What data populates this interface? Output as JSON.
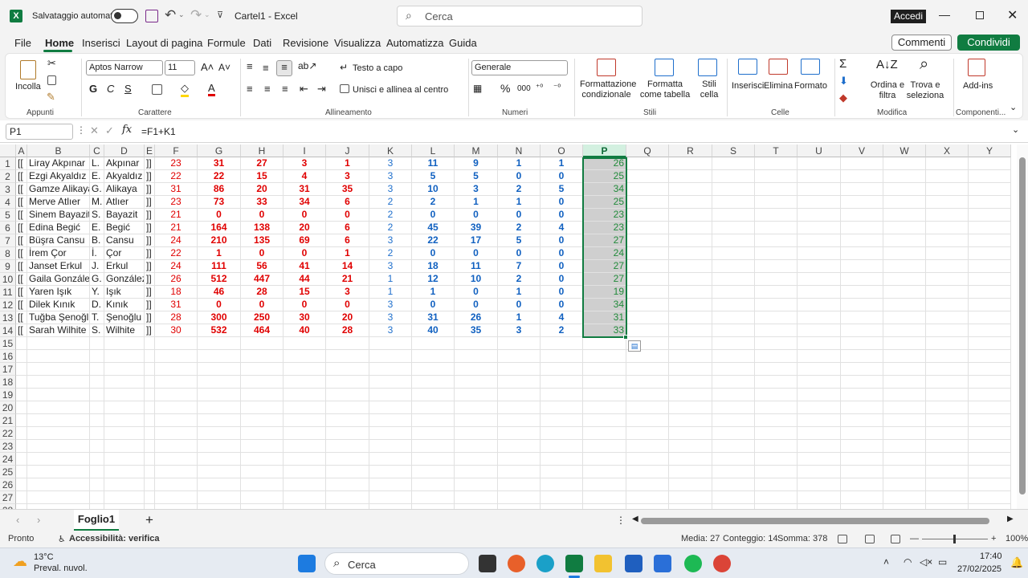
{
  "titlebar": {
    "autosave_label": "Salvataggio automatico",
    "doc_title": "Cartel1 - Excel",
    "search_placeholder": "Cerca",
    "signin_label": "Accedi",
    "app_icon_letter": "X"
  },
  "menu": {
    "items": [
      "File",
      "Home",
      "Inserisci",
      "Layout di pagina",
      "Formule",
      "Dati",
      "Revisione",
      "Visualizza",
      "Automatizza",
      "Guida"
    ],
    "comments_label": "Commenti",
    "share_label": "Condividi"
  },
  "ribbon": {
    "appunti": {
      "label": "Appunti",
      "paste": "Incolla"
    },
    "carattere": {
      "label": "Carattere",
      "font": "Aptos Narrow",
      "size": "11",
      "bold": "G",
      "italic": "C",
      "underline": "S"
    },
    "allineamento": {
      "label": "Allineamento",
      "wrap": "Testo a capo",
      "merge": "Unisci e allinea al centro"
    },
    "numeri": {
      "label": "Numeri",
      "format": "Generale"
    },
    "stili": {
      "label": "Stili",
      "cond": "Formattazione condizionale",
      "table": "Formatta come tabella",
      "cell": "Stili cella"
    },
    "celle": {
      "label": "Celle",
      "insert": "Inserisci",
      "delete": "Elimina",
      "format": "Formato"
    },
    "modifica": {
      "label": "Modifica",
      "sort": "Ordina e filtra",
      "find": "Trova e seleziona"
    },
    "componenti": {
      "label": "Componenti...",
      "addins": "Add-ins"
    }
  },
  "formula": {
    "namebox": "P1",
    "fx": "fx",
    "content": "=F1+K1"
  },
  "columns": [
    "A",
    "B",
    "C",
    "D",
    "E",
    "F",
    "G",
    "H",
    "I",
    "J",
    "K",
    "L",
    "M",
    "N",
    "O",
    "P",
    "Q",
    "R",
    "S",
    "T",
    "U",
    "V",
    "W",
    "X",
    "Y"
  ],
  "selected_column": "P",
  "rows": [
    {
      "n": "1",
      "a": "[[",
      "b": "Liray Akpınar",
      "c": "L.",
      "d": "Akpınar",
      "e": "]]",
      "f": "23",
      "g": "31",
      "h": "27",
      "i": "3",
      "j": "1",
      "k": "3",
      "l": "11",
      "m": "9",
      "nn": "1",
      "o": "1",
      "p": "26"
    },
    {
      "n": "2",
      "a": "[[",
      "b": "Ezgi Akyaldız",
      "c": "E.",
      "d": "Akyaldız",
      "e": "]]",
      "f": "22",
      "g": "22",
      "h": "15",
      "i": "4",
      "j": "3",
      "k": "3",
      "l": "5",
      "m": "5",
      "nn": "0",
      "o": "0",
      "p": "25"
    },
    {
      "n": "3",
      "a": "[[",
      "b": "Gamze Alikaya",
      "c": "G.",
      "d": "Alikaya",
      "e": "]]",
      "f": "31",
      "g": "86",
      "h": "20",
      "i": "31",
      "j": "35",
      "k": "3",
      "l": "10",
      "m": "3",
      "nn": "2",
      "o": "5",
      "p": "34"
    },
    {
      "n": "4",
      "a": "[[",
      "b": "Merve Atlıer",
      "c": "M.",
      "d": "Atlıer",
      "e": "]]",
      "f": "23",
      "g": "73",
      "h": "33",
      "i": "34",
      "j": "6",
      "k": "2",
      "l": "2",
      "m": "1",
      "nn": "1",
      "o": "0",
      "p": "25"
    },
    {
      "n": "5",
      "a": "[[",
      "b": "Sinem Bayazit",
      "c": "S.",
      "d": "Bayazit",
      "e": "]]",
      "f": "21",
      "g": "0",
      "h": "0",
      "i": "0",
      "j": "0",
      "k": "2",
      "l": "0",
      "m": "0",
      "nn": "0",
      "o": "0",
      "p": "23"
    },
    {
      "n": "6",
      "a": "[[",
      "b": "Edina Begić",
      "c": "E.",
      "d": "Begić",
      "e": "]]",
      "f": "21",
      "g": "164",
      "h": "138",
      "i": "20",
      "j": "6",
      "k": "2",
      "l": "45",
      "m": "39",
      "nn": "2",
      "o": "4",
      "p": "23"
    },
    {
      "n": "7",
      "a": "[[",
      "b": "Büşra Cansu",
      "c": "B.",
      "d": "Cansu",
      "e": "]]",
      "f": "24",
      "g": "210",
      "h": "135",
      "i": "69",
      "j": "6",
      "k": "3",
      "l": "22",
      "m": "17",
      "nn": "5",
      "o": "0",
      "p": "27"
    },
    {
      "n": "8",
      "a": "[[",
      "b": "İrem Çor",
      "c": "İ.",
      "d": "Çor",
      "e": "]]",
      "f": "22",
      "g": "1",
      "h": "0",
      "i": "0",
      "j": "1",
      "k": "2",
      "l": "0",
      "m": "0",
      "nn": "0",
      "o": "0",
      "p": "24"
    },
    {
      "n": "9",
      "a": "[[",
      "b": "Janset Erkul",
      "c": "J.",
      "d": "Erkul",
      "e": "]]",
      "f": "24",
      "g": "111",
      "h": "56",
      "i": "41",
      "j": "14",
      "k": "3",
      "l": "18",
      "m": "11",
      "nn": "7",
      "o": "0",
      "p": "27"
    },
    {
      "n": "10",
      "a": "[[",
      "b": "Gaila González",
      "c": "G.",
      "d": "González",
      "e": "]]",
      "f": "26",
      "g": "512",
      "h": "447",
      "i": "44",
      "j": "21",
      "k": "1",
      "l": "12",
      "m": "10",
      "nn": "2",
      "o": "0",
      "p": "27"
    },
    {
      "n": "11",
      "a": "[[",
      "b": "Yaren Işık",
      "c": "Y.",
      "d": "Işık",
      "e": "]]",
      "f": "18",
      "g": "46",
      "h": "28",
      "i": "15",
      "j": "3",
      "k": "1",
      "l": "1",
      "m": "0",
      "nn": "1",
      "o": "0",
      "p": "19"
    },
    {
      "n": "12",
      "a": "[[",
      "b": "Dilek Kınık",
      "c": "D.",
      "d": "Kınık",
      "e": "]]",
      "f": "31",
      "g": "0",
      "h": "0",
      "i": "0",
      "j": "0",
      "k": "3",
      "l": "0",
      "m": "0",
      "nn": "0",
      "o": "0",
      "p": "34"
    },
    {
      "n": "13",
      "a": "[[",
      "b": "Tuğba Şenoğlu",
      "c": "T.",
      "d": "Şenoğlu",
      "e": "]]",
      "f": "28",
      "g": "300",
      "h": "250",
      "i": "30",
      "j": "20",
      "k": "3",
      "l": "31",
      "m": "26",
      "nn": "1",
      "o": "4",
      "p": "31"
    },
    {
      "n": "14",
      "a": "[[",
      "b": "Sarah Wilhite",
      "c": "S.",
      "d": "Wilhite",
      "e": "]]",
      "f": "30",
      "g": "532",
      "h": "464",
      "i": "40",
      "j": "28",
      "k": "3",
      "l": "40",
      "m": "35",
      "nn": "3",
      "o": "2",
      "p": "33"
    }
  ],
  "empty_rows": [
    "15",
    "16",
    "17",
    "18",
    "19",
    "20",
    "21",
    "22",
    "23",
    "24",
    "25",
    "26",
    "27",
    "28"
  ],
  "sheet": {
    "tab": "Foglio1",
    "add": "+"
  },
  "status": {
    "ready": "Pronto",
    "accessibility": "Accessibilità: verifica",
    "media": "Media: 27",
    "conteggio": "Conteggio: 14",
    "somma": "Somma: 378",
    "zoom": "100%"
  },
  "taskbar": {
    "temp": "13°C",
    "weather": "Preval. nuvol.",
    "search": "Cerca",
    "time": "17:40",
    "date": "27/02/2025"
  }
}
